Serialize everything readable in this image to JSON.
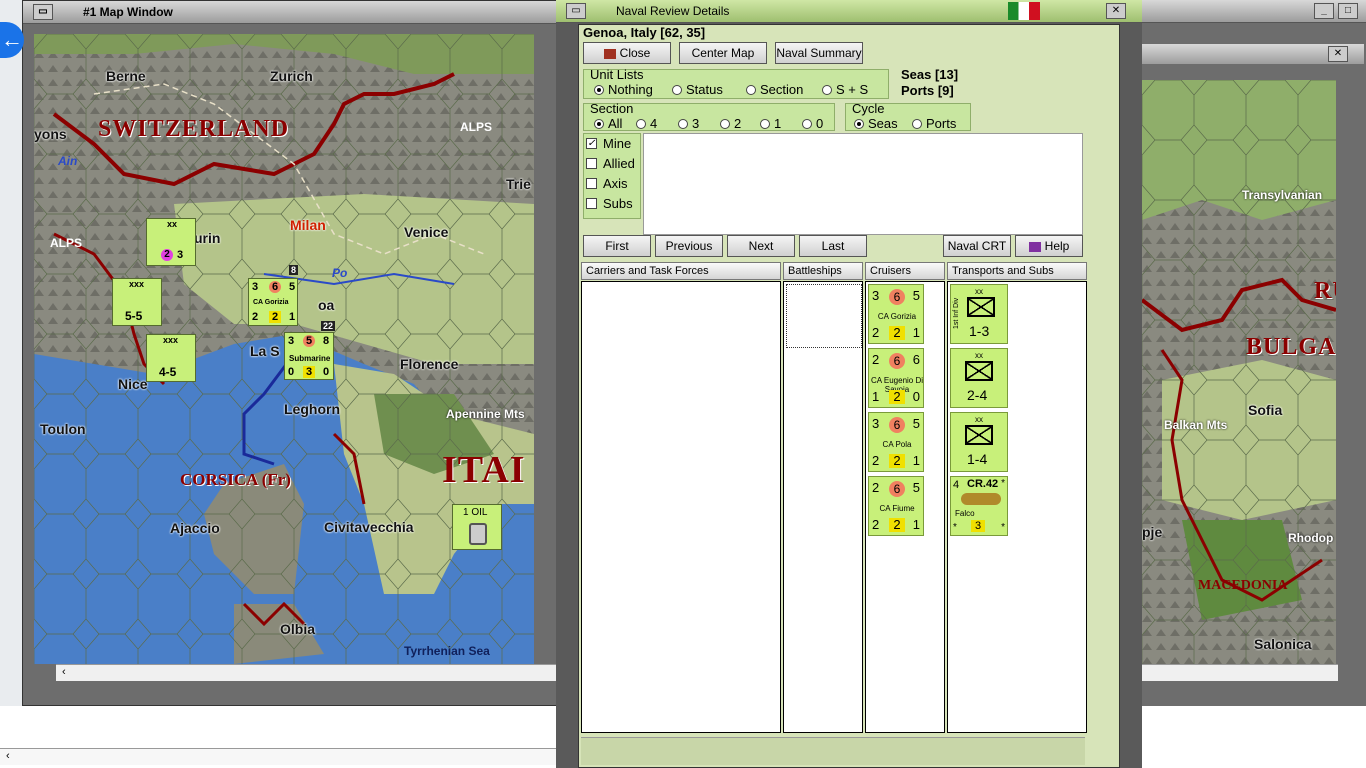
{
  "map_window": {
    "title": "#1 Map Window",
    "labels": {
      "switzerland": "SWITZERLAND",
      "italy": "ITAI",
      "corsica": "CORSICA (Fr)",
      "alps1": "ALPS",
      "alps2": "ALPS",
      "berne": "Berne",
      "zurich": "Zurich",
      "lyons": "yons",
      "ain": "Ain",
      "turin": "urin",
      "milan": "Milan",
      "venice": "Venice",
      "trieste": "Trie",
      "po": "Po",
      "genoa": "oa",
      "la_spezia": "La S",
      "nice": "Nice",
      "toulon": "Toulon",
      "florence": "Florence",
      "leghorn": "Leghorn",
      "apennine": "Apennine Mts",
      "ajaccio": "Ajaccio",
      "civitavecchia": "Civitavecchia",
      "olbia": "Olbia",
      "tyrrhenian": "Tyrrhenian Sea"
    },
    "units": {
      "u1_top": "xx",
      "u1_vals": [
        "2",
        "3"
      ],
      "u2_top": "xxx",
      "u2_val": "5-5",
      "u3_top": "xxx",
      "u3_val": "4-5",
      "u4_badge": "8",
      "u4_top": [
        "3",
        "6",
        "5"
      ],
      "u4_name": "CA Gorizia",
      "u4_bot": [
        "2",
        "2",
        "1"
      ],
      "u5_badge": "22",
      "u5_top": [
        "3",
        "5",
        "8"
      ],
      "u5_name": "Submarine",
      "u5_bot": [
        "0",
        "3",
        "0"
      ],
      "oil": "1 OIL"
    }
  },
  "right_window": {
    "labels": {
      "transylvanian": "Transylvanian",
      "bulgaria": "BULGA",
      "ru": "RU",
      "sofia": "Sofia",
      "balkan": "Balkan Mts",
      "skopje": "pje",
      "rhodope": "Rhodop",
      "macedonia": "MACEDONIA",
      "salonica": "Salonica"
    }
  },
  "dialog": {
    "title": "Naval Review Details",
    "location": "Genoa, Italy [62, 35]",
    "buttons": {
      "close": "Close",
      "center_map": "Center Map",
      "naval_summary": "Naval Summary",
      "first": "First",
      "previous": "Previous",
      "next": "Next",
      "last": "Last",
      "naval_crt": "Naval CRT",
      "help": "Help"
    },
    "unit_lists": {
      "title": "Unit Lists",
      "options": [
        "Nothing",
        "Status",
        "Section",
        "S + S"
      ],
      "selected": "Nothing"
    },
    "counts": {
      "seas": "Seas [13]",
      "ports": "Ports [9]"
    },
    "section": {
      "title": "Section",
      "options": [
        "All",
        "4",
        "3",
        "2",
        "1",
        "0"
      ],
      "selected": "All"
    },
    "cycle": {
      "title": "Cycle",
      "options": [
        "Seas",
        "Ports"
      ],
      "selected": "Seas"
    },
    "filters": [
      {
        "label": "Mine",
        "checked": true
      },
      {
        "label": "Allied",
        "checked": false
      },
      {
        "label": "Axis",
        "checked": false
      },
      {
        "label": "Subs",
        "checked": false
      }
    ],
    "columns": [
      "Carriers and Task Forces",
      "Battleships",
      "Cruisers",
      "Transports and Subs"
    ],
    "cruisers": [
      {
        "top": [
          "3",
          "6",
          "5"
        ],
        "name": "CA Gorizia",
        "bot": [
          "2",
          "2",
          "1"
        ]
      },
      {
        "top": [
          "2",
          "6",
          "6"
        ],
        "name": "CA Eugenio Di Savoia",
        "bot": [
          "1",
          "2",
          "0"
        ]
      },
      {
        "top": [
          "3",
          "6",
          "5"
        ],
        "name": "CA Pola",
        "bot": [
          "2",
          "2",
          "1"
        ]
      },
      {
        "top": [
          "2",
          "6",
          "5"
        ],
        "name": "CA Fiume",
        "bot": [
          "2",
          "2",
          "1"
        ]
      }
    ],
    "transports": [
      {
        "top": "xx",
        "side": "1st Inf Div",
        "val": "1-3"
      },
      {
        "top": "xx",
        "val": "2-4"
      },
      {
        "top": "xx",
        "val": "1-4"
      },
      {
        "top": "CR.42",
        "side": "4",
        "name": "Falco",
        "val": "3",
        "star": "*"
      }
    ]
  },
  "colors": {
    "dialog_bg": "#d7e4b9",
    "counter": "#c8f07a",
    "border_red": "#8b0000"
  }
}
